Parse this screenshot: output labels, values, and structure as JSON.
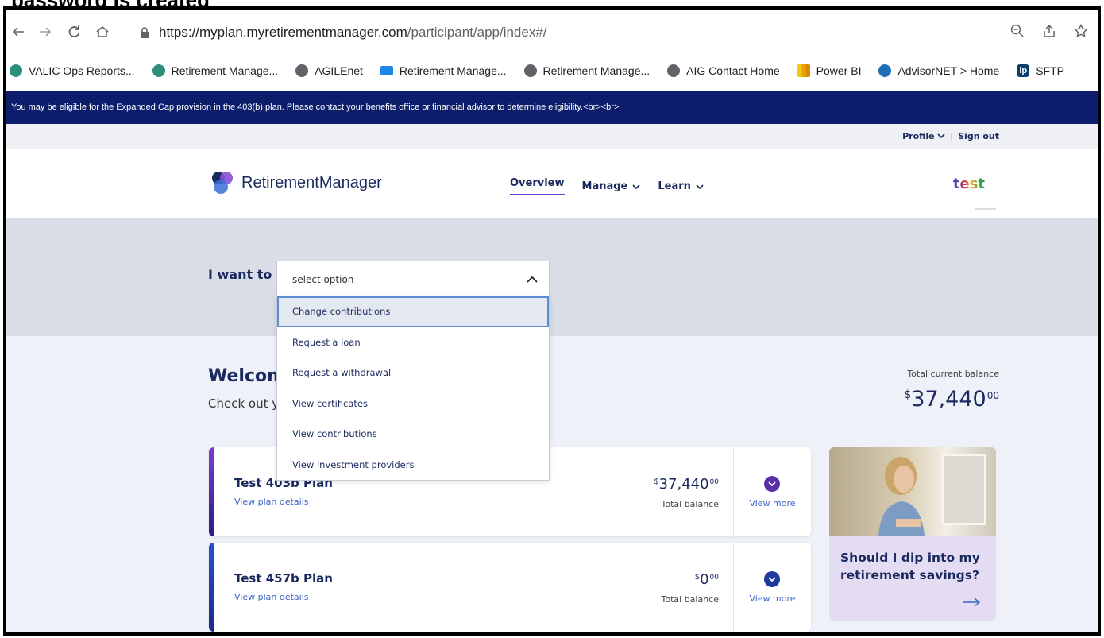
{
  "caption": "password is created",
  "browser": {
    "url_host": "https://myplan.myretirementmanager.com",
    "url_path": "/participant/app/index#/",
    "bookmarks": [
      {
        "label": "VALIC Ops Reports...",
        "icon": "sharepoint-icon"
      },
      {
        "label": "Retirement Manage...",
        "icon": "sharepoint-icon"
      },
      {
        "label": "AGILEnet",
        "icon": "globe-icon"
      },
      {
        "label": "Retirement Manage...",
        "icon": "valic-icon"
      },
      {
        "label": "Retirement Manage...",
        "icon": "globe-icon"
      },
      {
        "label": "AIG Contact Home",
        "icon": "globe-icon"
      },
      {
        "label": "Power BI",
        "icon": "powerbi-icon"
      },
      {
        "label": "AdvisorNET > Home",
        "icon": "advisornet-icon"
      },
      {
        "label": "SFTP",
        "icon": "ip-icon"
      }
    ],
    "ip_icon_text": "ip"
  },
  "banner": {
    "text": "You may be eligible for the Expanded Cap provision in the 403(b) plan. Please contact your benefits office or financial advisor to determine eligibility.<br><br>"
  },
  "profile": {
    "profile_label": "Profile",
    "separator": "|",
    "signout_label": "Sign out"
  },
  "header": {
    "logo_text": "RetirementManager",
    "nav": {
      "overview": "Overview",
      "manage": "Manage",
      "learn": "Learn"
    },
    "test_logo": "test"
  },
  "hero": {
    "iwant_label": "I want to",
    "select_value": "select option",
    "options": [
      "Change contributions",
      "Request a loan",
      "Request a withdrawal",
      "View certificates",
      "View contributions",
      "View investment providers"
    ]
  },
  "main": {
    "welcome": "Welcom",
    "checkout": "Check out y",
    "total_label": "Total current balance",
    "total_currency": "$",
    "total_whole": "37,440",
    "total_cents": "00",
    "plans": [
      {
        "name": "Test 403b Plan",
        "link": "View plan details",
        "currency": "$",
        "whole": "37,440",
        "cents": "00",
        "balance_label": "Total balance",
        "more": "View more"
      },
      {
        "name": "Test 457b Plan",
        "link": "View plan details",
        "currency": "$",
        "whole": "0",
        "cents": "00",
        "balance_label": "Total balance",
        "more": "View more"
      }
    ],
    "promo_text": "Should I dip into my retirement savings?"
  },
  "colors": {
    "banner_bg": "#0b1d6b",
    "brand_navy": "#1b2a5e",
    "accent_purple": "#6b3fc8",
    "link_blue": "#3a63c8"
  }
}
